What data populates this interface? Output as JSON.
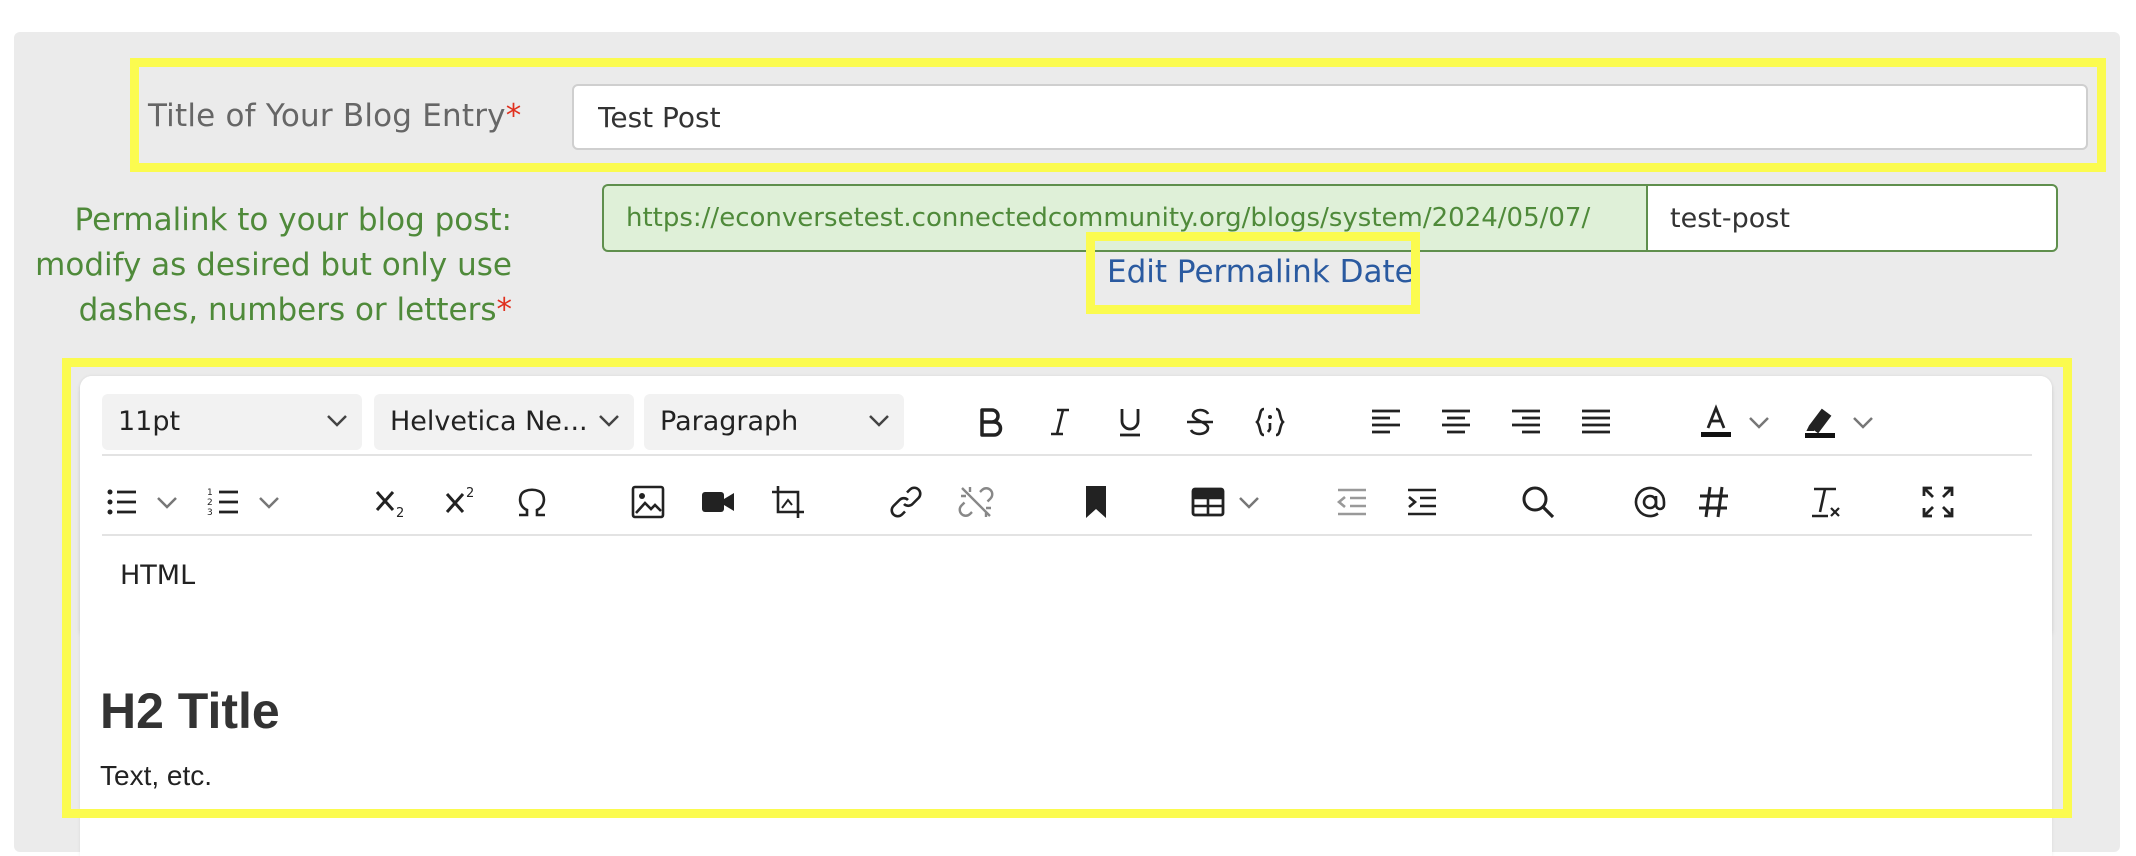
{
  "form": {
    "title_label": "Title of Your Blog Entry",
    "required_mark": "*",
    "title_value": "Test Post",
    "permalink_label_line1": "Permalink to your blog post:",
    "permalink_label_line2": "modify as desired but only use",
    "permalink_label_line3": "dashes, numbers or letters",
    "permalink_prefix": "https://econversetest.connectedcommunity.org/blogs/system/2024/05/07/",
    "permalink_slug": "test-post",
    "edit_permalink_date": "Edit Permalink Date"
  },
  "toolbar": {
    "font_size": "11pt",
    "font_family": "Helvetica Ne...",
    "block_format": "Paragraph",
    "html_label": "HTML"
  },
  "content": {
    "heading": "H2 Title",
    "paragraph": "Text, etc."
  },
  "colors": {
    "highlight": "#fbfb4f",
    "required": "#e0301e",
    "permalink_green": "#4f8a3a",
    "link_blue": "#2a5aa0"
  },
  "icons": {
    "row1": [
      "bold-icon",
      "italic-icon",
      "underline-icon",
      "strikethrough-icon",
      "code-icon",
      "align-left-icon",
      "align-center-icon",
      "align-right-icon",
      "align-justify-icon",
      "text-color-icon",
      "highlight-color-icon"
    ],
    "row2": [
      "bullet-list-icon",
      "numbered-list-icon",
      "subscript-icon",
      "superscript-icon",
      "special-character-icon",
      "image-icon",
      "video-icon",
      "crop-icon",
      "link-icon",
      "unlink-icon",
      "bookmark-icon",
      "table-icon",
      "outdent-icon",
      "indent-icon",
      "search-icon",
      "mention-icon",
      "hashtag-icon",
      "clear-formatting-icon",
      "fullscreen-icon"
    ]
  }
}
